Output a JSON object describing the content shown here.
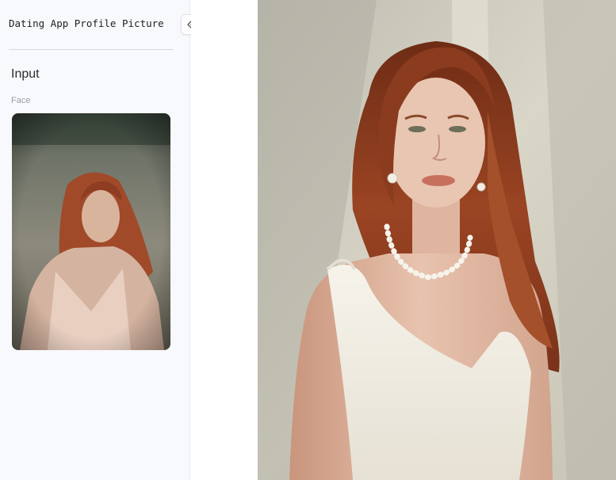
{
  "app": {
    "title": "Dating App Profile Picture"
  },
  "sidebar": {
    "section_heading": "Input",
    "field_label": "Face",
    "collapse_icon": "double-chevron-left-icon"
  },
  "colors": {
    "sidebar_bg": "#f8f9fc",
    "hair": "#8a3a1e",
    "dress": "#f1ede4",
    "wall": "#cfcdc0"
  }
}
